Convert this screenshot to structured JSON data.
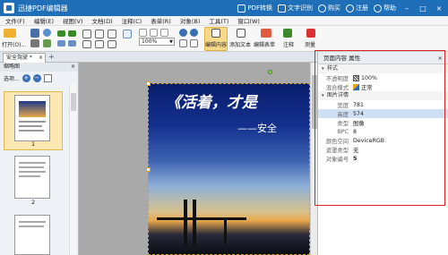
{
  "app": {
    "title": "迅捷PDF编辑器",
    "header_actions": [
      {
        "label": "PDF转换",
        "icon": "convert-icon"
      },
      {
        "label": "文字识别",
        "icon": "ocr-icon"
      },
      {
        "label": "购买",
        "icon": "cart-icon"
      },
      {
        "label": "注册",
        "icon": "user-icon"
      },
      {
        "label": "帮助",
        "icon": "help-icon"
      }
    ],
    "window_controls": [
      "–",
      "□",
      "×"
    ]
  },
  "menu": [
    "文件(F)",
    "编辑(E)",
    "视图(V)",
    "文档(D)",
    "注释(C)",
    "表单(R)",
    "对象(B)",
    "工具(T)",
    "窗口(W)"
  ],
  "toolbar": {
    "open_label": "打开(O)...",
    "zoom_value": "100%",
    "edit_content_label": "编辑内容",
    "add_text_label": "添加文本",
    "edit_form_label": "编辑表单",
    "annotate_label": "注释",
    "measure_label": "测量"
  },
  "tabs": {
    "doc_tab": "安全驾驶 *",
    "close": "×",
    "add": "+"
  },
  "thumbnails": {
    "title": "缩略图",
    "options_label": "选项...",
    "pages": [
      "1",
      "2"
    ]
  },
  "document": {
    "line1": "《活着，才是",
    "line2": "——安全"
  },
  "properties": {
    "title": "页面内容 属性",
    "sections": {
      "style": "样式",
      "image": "图片详情"
    },
    "style_rows": [
      {
        "label": "不透明度",
        "value": "100%"
      },
      {
        "label": "混合模式",
        "value": "正常"
      }
    ],
    "image_rows": [
      {
        "label": "宽度",
        "value": "781"
      },
      {
        "label": "高度",
        "value": "574"
      },
      {
        "label": "类型",
        "value": "图像"
      },
      {
        "label": "BPC",
        "value": "8"
      },
      {
        "label": "颜色空间",
        "value": "DeviceRGB"
      },
      {
        "label": "遮罩类型",
        "value": "无"
      },
      {
        "label": "对象编号",
        "value": "5"
      }
    ]
  },
  "colors": {
    "titlebar": "#1e6fb8",
    "highlight_frame": "#e02020",
    "selected_row": "#cfe0f5"
  }
}
